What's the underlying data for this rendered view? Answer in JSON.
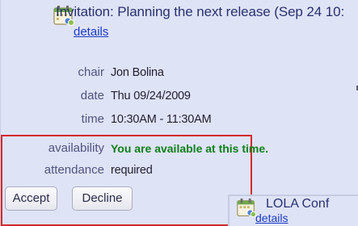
{
  "event": {
    "title": "Invitation: Planning the next release (Sep 24 10:",
    "details_link": "details",
    "fields": [
      {
        "label": "chair",
        "value": "Jon Bolina"
      },
      {
        "label": "date",
        "value": "Thu 09/24/2009"
      },
      {
        "label": "time",
        "value": "10:30AM - 11:30AM"
      }
    ],
    "availability_label": "availability",
    "availability_value": "You are available at this time.",
    "attendance_label": "attendance",
    "attendance_value": "required",
    "accept_label": "Accept",
    "decline_label": "Decline"
  },
  "second_event": {
    "title": "LOLA Conf",
    "details_link": "details"
  },
  "colors": {
    "card_bg": "#dfe3f6",
    "link": "#1b3cc4",
    "available": "#0f7f1a",
    "highlight_border": "#d32a2a"
  },
  "icons": [
    "calendar-icon",
    "calendar-icon"
  ]
}
